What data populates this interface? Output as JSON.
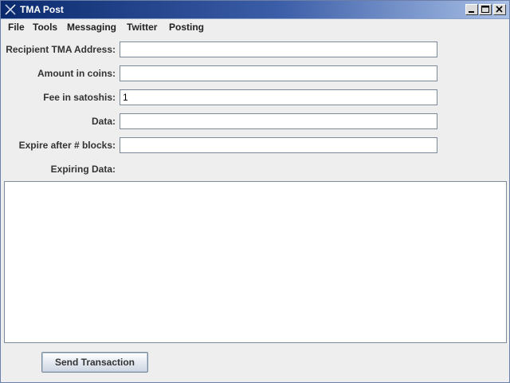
{
  "window": {
    "title": "TMA Post",
    "titlebar_color": "#0b2a6e",
    "controls": [
      "minimize-icon",
      "maximize-icon",
      "close-icon"
    ]
  },
  "menu": {
    "items": [
      "File",
      "Tools",
      "Messaging",
      "Twitter",
      "Posting"
    ]
  },
  "form": {
    "recipient": {
      "label": "Recipient TMA Address:",
      "value": ""
    },
    "amount": {
      "label": "Amount in coins:",
      "value": ""
    },
    "fee": {
      "label": "Fee in satoshis:",
      "value": "1"
    },
    "data": {
      "label": "Data:",
      "value": ""
    },
    "expire": {
      "label": "Expire after # blocks:",
      "value": ""
    },
    "expiring_data": {
      "label": "Expiring Data:",
      "value": ""
    }
  },
  "actions": {
    "send_label": "Send Transaction"
  }
}
